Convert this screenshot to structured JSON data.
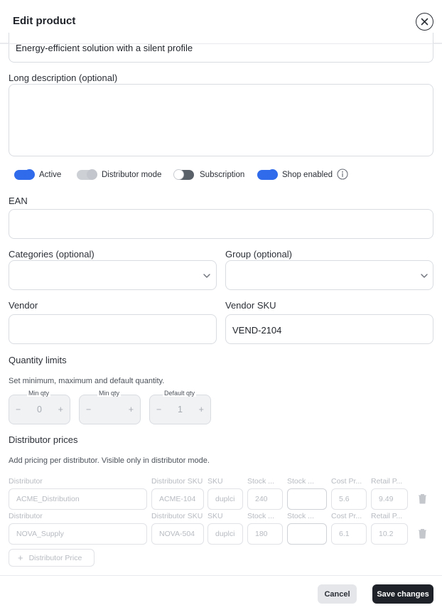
{
  "header": {
    "title": "Edit product"
  },
  "short_description": {
    "value": "Energy-efficient solution with a silent profile"
  },
  "long_description": {
    "label": "Long description (optional)",
    "value": ""
  },
  "toggles": [
    {
      "label": "Active",
      "on": true,
      "disabled": false
    },
    {
      "label": "Distributor mode",
      "on": true,
      "disabled": true
    },
    {
      "label": "Subscription",
      "on": false,
      "disabled": false
    },
    {
      "label": "Shop enabled",
      "on": true,
      "disabled": false
    }
  ],
  "ean": {
    "label": "EAN",
    "value": ""
  },
  "categories": {
    "label": "Categories (optional)",
    "value": ""
  },
  "group": {
    "label": "Group (optional)",
    "value": ""
  },
  "vendor": {
    "label": "Vendor",
    "value": ""
  },
  "vendor_sku": {
    "label": "Vendor SKU",
    "value": "VEND-2104"
  },
  "quantity_limits": {
    "title": "Quantity limits",
    "help": "Set minimum, maximum and default quantity.",
    "steppers": [
      {
        "caption": "Min qty",
        "value": "0"
      },
      {
        "caption": "Min qty",
        "value": ""
      },
      {
        "caption": "Default qty",
        "value": "1"
      }
    ]
  },
  "distributor_prices": {
    "title": "Distributor prices",
    "help": "Add pricing per distributor. Visible only in distributor mode.",
    "columns": [
      "Distributor",
      "Distributor SKU",
      "SKU",
      "Stock ...",
      "Stock ...",
      "Cost Pr...",
      "Retail P..."
    ],
    "rows": [
      {
        "distributor": "ACME_Distribution",
        "distributor_sku": "ACME-104",
        "sku": "duplci",
        "stock": "240",
        "stock2": "",
        "cost": "5.6",
        "retail": "9.49"
      },
      {
        "distributor": "NOVA_Supply",
        "distributor_sku": "NOVA-504",
        "sku": "duplci",
        "stock": "180",
        "stock2": "",
        "cost": "6.1",
        "retail": "10.2"
      }
    ],
    "add_label": "Distributor Price"
  },
  "footer": {
    "cancel_label": "Cancel",
    "save_label": "Save changes"
  },
  "colors": {
    "accent": "#2f6bea",
    "accent_light": "#9ab8f4",
    "dark": "#1f2329"
  }
}
